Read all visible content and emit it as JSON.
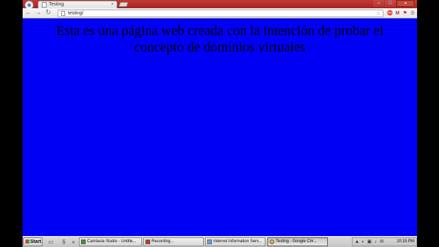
{
  "browser": {
    "tab_title": "Testing",
    "tab_close": "×",
    "url": "testing/",
    "controls": {
      "minimize": "–",
      "maximize": "□",
      "close": "×"
    },
    "nav": {
      "back": "←",
      "forward": "→",
      "reload": "↻"
    },
    "extensions": [
      "⛔",
      "M",
      "⚑",
      "☰"
    ],
    "star": "☆"
  },
  "page": {
    "headline": "Esta es una página web creada con la intención de probar el concepto de dominios virtuales",
    "background": "#0000f5"
  },
  "taskbar": {
    "start_label": "Start",
    "quick_launch": [
      "▭",
      "§",
      "»"
    ],
    "tasks": [
      {
        "label": "Camtasia Studio - Untitle...",
        "active": false
      },
      {
        "label": "Recording...",
        "active": false
      },
      {
        "label": "Internet Information Serv...",
        "active": false
      },
      {
        "label": "Testing - Google Chr...",
        "active": true
      }
    ],
    "tray_icons": [
      "▲",
      "◐",
      "▣",
      "♪",
      "✉"
    ],
    "clock": "10:15 PM"
  }
}
